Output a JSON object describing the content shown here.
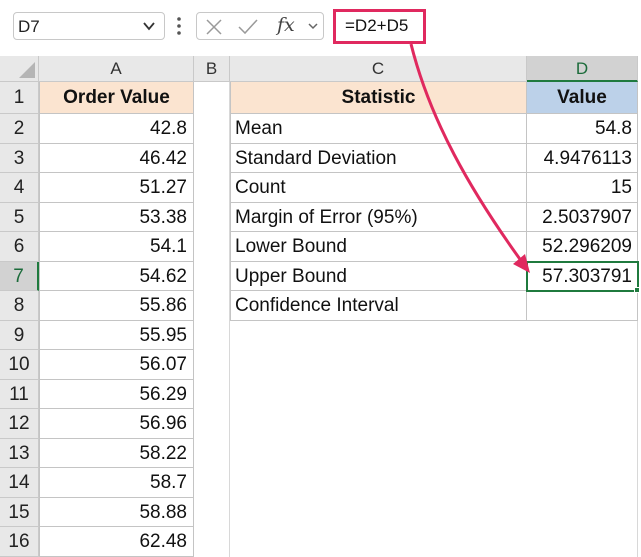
{
  "formula_bar": {
    "name_box": "D7",
    "fx_label": "fx",
    "formula": "=D2+D5"
  },
  "columns": [
    "A",
    "B",
    "C",
    "D"
  ],
  "rows": [
    "1",
    "2",
    "3",
    "4",
    "5",
    "6",
    "7",
    "8",
    "9",
    "10",
    "11",
    "12",
    "13",
    "14",
    "15",
    "16"
  ],
  "sheet": {
    "a_header": "Order Value",
    "a_values": [
      "42.8",
      "46.42",
      "51.27",
      "53.38",
      "54.1",
      "54.62",
      "55.86",
      "55.95",
      "56.07",
      "56.29",
      "56.96",
      "58.22",
      "58.7",
      "58.88",
      "62.48"
    ],
    "c_header": "Statistic",
    "d_header": "Value",
    "stats": [
      {
        "label": "Mean",
        "value": "54.8"
      },
      {
        "label": "Standard Deviation",
        "value": "4.9476113"
      },
      {
        "label": "Count",
        "value": "15"
      },
      {
        "label": "Margin of Error (95%)",
        "value": "2.5037907"
      },
      {
        "label": "Lower Bound",
        "value": "52.296209"
      },
      {
        "label": "Upper Bound",
        "value": "57.303791"
      },
      {
        "label": "Confidence Interval",
        "value": ""
      }
    ]
  },
  "colors": {
    "highlight": "#e0295f",
    "selection": "#1f7a3e",
    "header_fill": "#fbe4d0",
    "value_header_fill": "#bcd1e9"
  }
}
